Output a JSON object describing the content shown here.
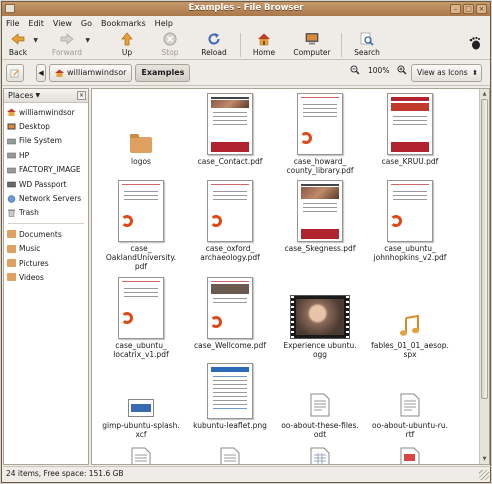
{
  "window": {
    "title": "Examples - File Browser"
  },
  "menu": [
    "File",
    "Edit",
    "View",
    "Go",
    "Bookmarks",
    "Help"
  ],
  "toolbar": {
    "back": "Back",
    "forward": "Forward",
    "up": "Up",
    "stop": "Stop",
    "reload": "Reload",
    "home": "Home",
    "computer": "Computer",
    "search": "Search"
  },
  "location": {
    "crumbs": [
      "williamwindsor",
      "Examples"
    ],
    "zoom": "100%",
    "view_mode": "View as Icons"
  },
  "sidebar": {
    "header": "Places",
    "items": [
      "williamwindsor",
      "Desktop",
      "File System",
      "HP",
      "FACTORY_IMAGE",
      "WD Passport",
      "Network Servers",
      "Trash"
    ],
    "bookmarks": [
      "Documents",
      "Music",
      "Pictures",
      "Videos"
    ]
  },
  "files": [
    "logos",
    "case_Contact.pdf",
    "case_howard_county_library.pdf",
    "case_KRUU.pdf",
    "case_OaklandUniversity.pdf",
    "case_oxford_archaeology.pdf",
    "case_Skegness.pdf",
    "case_ubuntu_johnhopkins_v2.pdf",
    "case_ubuntu_locatrix_v1.pdf",
    "case_Wellcome.pdf",
    "Experience ubuntu.ogg",
    "fables_01_01_aesop.spx",
    "gimp-ubuntu-splash.xcf",
    "kubuntu-leaflet.png",
    "oo-about-these-files.odt",
    "oo-about-ubuntu-ru.rtf"
  ],
  "files_display": [
    "logos",
    "case_Contact.pdf",
    "case_howard_\ncounty_library.pdf",
    "case_KRUU.pdf",
    "case_\nOaklandUniversity.\npdf",
    "case_oxford_\narchaeology.pdf",
    "case_Skegness.pdf",
    "case_ubuntu_\njohnhopkins_v2.pdf",
    "case_ubuntu_\nlocatrix_v1.pdf",
    "case_Wellcome.pdf",
    "Experience ubuntu.\nogg",
    "fables_01_01_aesop.\nspx",
    "gimp-ubuntu-splash.\nxcf",
    "kubuntu-leaflet.png",
    "oo-about-these-files.\nodt",
    "oo-about-ubuntu-ru.\nrtf"
  ],
  "status": "24 items, Free space: 151.6 GB",
  "colors": {
    "titlebar": "#b8875a",
    "ubuntu_orange": "#dd4814",
    "folder": "#e0a060"
  }
}
